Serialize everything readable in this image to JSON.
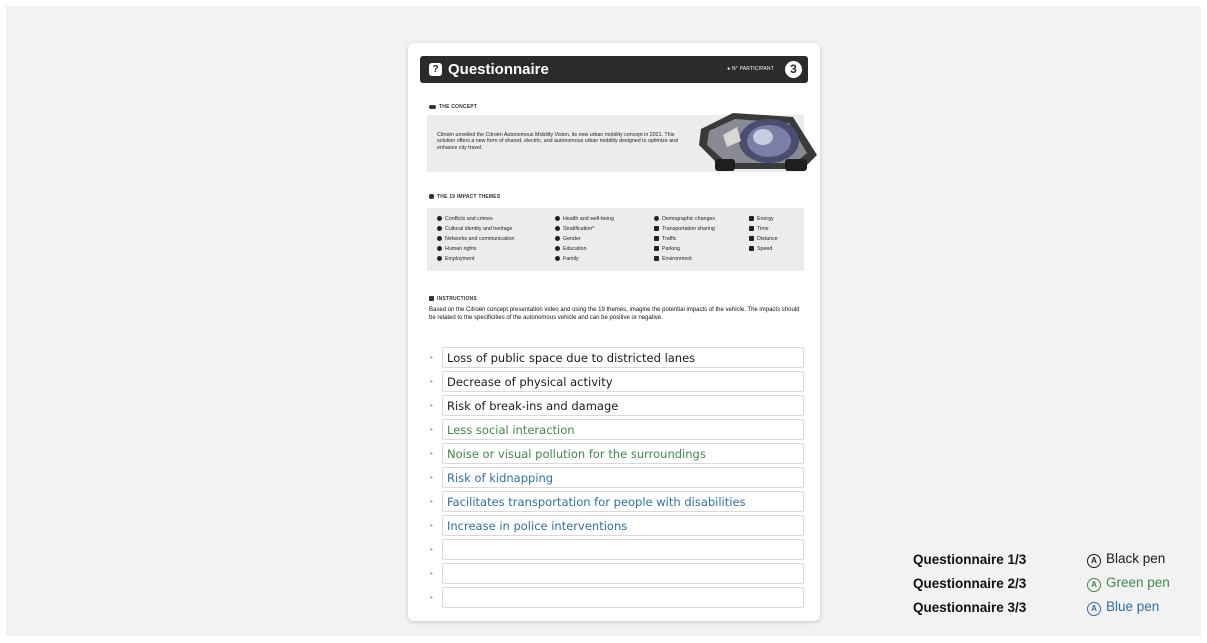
{
  "questionnaire": {
    "title": "Questionnaire",
    "participant_label": "N° PARTICIPANT",
    "participant_number": "3",
    "concept": {
      "label": "THE CONCEPT",
      "text": "Citroën unveiled the Citroën Autonomous Mobility Vision, its new urban mobility concept in 2021. This solution offers a new form of shared, electric, and autonomous urban mobility designed to optimize and enhance city travel."
    },
    "themes": {
      "label": "THE 19 IMPACT THEMES",
      "columns": [
        [
          "Conflicts and crimes",
          "Cultural identity and heritage",
          "Networks and communication",
          "Human rights",
          "Employment"
        ],
        [
          "Health and well-being",
          "Stratification*",
          "Gender",
          "Education",
          "Family"
        ],
        [
          "Demographic changes",
          "Transportation sharing",
          "Traffic",
          "Parking",
          "Environment"
        ],
        [
          "Energy",
          "Time",
          "Distance",
          "Speed"
        ]
      ]
    },
    "instructions": {
      "label": "INSTRUCTIONS",
      "text": "Based on the Citroën concept presentation video and using the 19 themes, imagine the potential impacts of the vehicle. The impacts should be related to the specificities of the autonomous vehicle and can be positive or negative."
    },
    "answers": [
      {
        "text": "Loss of public space due to districted lanes",
        "pen": "black"
      },
      {
        "text": "Decrease of physical activity",
        "pen": "black"
      },
      {
        "text": "Risk of break-ins and damage",
        "pen": "black"
      },
      {
        "text": "Less social interaction",
        "pen": "green"
      },
      {
        "text": "Noise or visual pollution for the surroundings",
        "pen": "green"
      },
      {
        "text": "Risk of kidnapping",
        "pen": "blue"
      },
      {
        "text": "Facilitates transportation for people with disabilities",
        "pen": "blue"
      },
      {
        "text": "Increase in police interventions",
        "pen": "blue"
      },
      {
        "text": "",
        "pen": ""
      },
      {
        "text": "",
        "pen": ""
      },
      {
        "text": "",
        "pen": ""
      }
    ]
  },
  "legend": [
    {
      "label": "Questionnaire 1/3",
      "pen_label": "Black pen",
      "pen_icon": "Ⓐ",
      "color": "#1a1a1a"
    },
    {
      "label": "Questionnaire 2/3",
      "pen_label": "Green pen",
      "pen_icon": "Ⓐ",
      "color": "#3f8a4a"
    },
    {
      "label": "Questionnaire 3/3",
      "pen_label": "Blue pen",
      "pen_icon": "Ⓐ",
      "color": "#2f6fa8"
    }
  ],
  "pen_colors": {
    "black": "#1a1a1a",
    "green": "#3f8a4a",
    "blue": "#2f6fa8"
  }
}
